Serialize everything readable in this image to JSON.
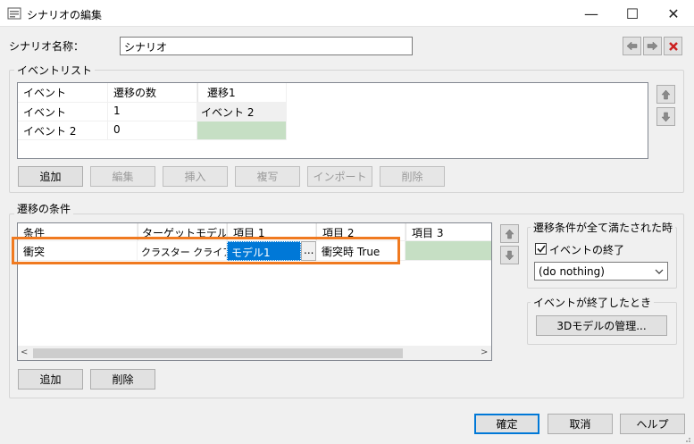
{
  "window": {
    "title": "シナリオの編集"
  },
  "scenario": {
    "label": "シナリオ名称：",
    "value": "シナリオ"
  },
  "event_list": {
    "title": "イベントリスト",
    "headers": [
      "イベント",
      "遷移の数",
      "遷移1"
    ],
    "rows": [
      [
        "イベント",
        "1",
        "イベント 2"
      ],
      [
        "イベント 2",
        "0",
        ""
      ]
    ],
    "buttons": [
      "追加",
      "編集",
      "挿入",
      "複写",
      "インポート",
      "削除"
    ]
  },
  "conditions": {
    "title": "遷移の条件",
    "headers": [
      "条件",
      "ターゲットモデル",
      "項目 1",
      "項目 2",
      "項目 3"
    ],
    "row": {
      "condition": "衝突",
      "target": "クラスター クライアント ...",
      "item1": "モデル1",
      "item1_ellipsis": "...",
      "item2": "衝突時 True",
      "item3": ""
    },
    "buttons": [
      "追加",
      "削除"
    ]
  },
  "all_met": {
    "title": "遷移条件が全て満たされた時",
    "checkbox_label": "イベントの終了",
    "checkbox_checked": true,
    "combo_value": "(do nothing)"
  },
  "event_end": {
    "title": "イベントが終了したとき",
    "button": "3Dモデルの管理..."
  },
  "footer": {
    "ok": "確定",
    "cancel": "取消",
    "help": "ヘルプ"
  },
  "colors": {
    "accent": "#0078d7",
    "highlight": "#f07a20",
    "green_cell": "#c6dfc4",
    "nav_close": "#cc1f1f"
  }
}
